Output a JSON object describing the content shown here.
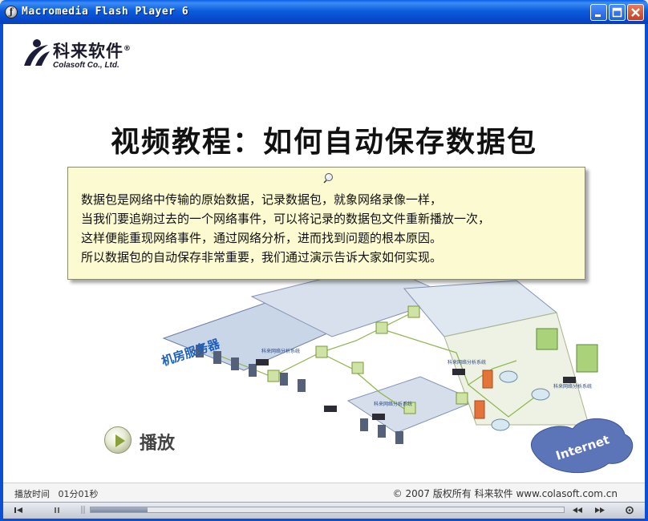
{
  "window": {
    "title": "Macromedia Flash Player 6",
    "controls": [
      "minimize",
      "maximize",
      "close"
    ]
  },
  "logo": {
    "name_cn": "科来软件",
    "mark": "®",
    "name_en": "Colasoft Co., Ltd."
  },
  "slide": {
    "title": "视频教程：如何自动保存数据包",
    "note_lines": [
      "数据包是网络中传输的原始数据，记录数据包，就象网络录像一样，",
      "当我们要追朔过去的一个网络事件，可以将记录的数据包文件重新播放一次，",
      "这样便能重现网络事件，通过网络分析，进而找到问题的根本原因。",
      "所以数据包的自动保存非常重要，我们通过演示告诉大家如何实现。"
    ],
    "diagram": {
      "server_room_label": "机房服务器",
      "internet_label": "Internet",
      "analyzer_label": "科来网络分析系统"
    },
    "play_label": "播放"
  },
  "status": {
    "time_label": "播放时间",
    "time_value": "01分01秒",
    "copyright": "© 2007 版权所有  科来软件  www.colasoft.com.cn"
  },
  "player": {
    "progress": 0.12,
    "icons": [
      "rewind-to-start-icon",
      "pause-icon",
      "rewind-icon",
      "fast-forward-icon",
      "end-icon",
      "settings-icon"
    ]
  },
  "colors": {
    "titlebar": "#0b5ddc",
    "note_background": "#fcfad0",
    "accent_green": "#8aa038"
  }
}
